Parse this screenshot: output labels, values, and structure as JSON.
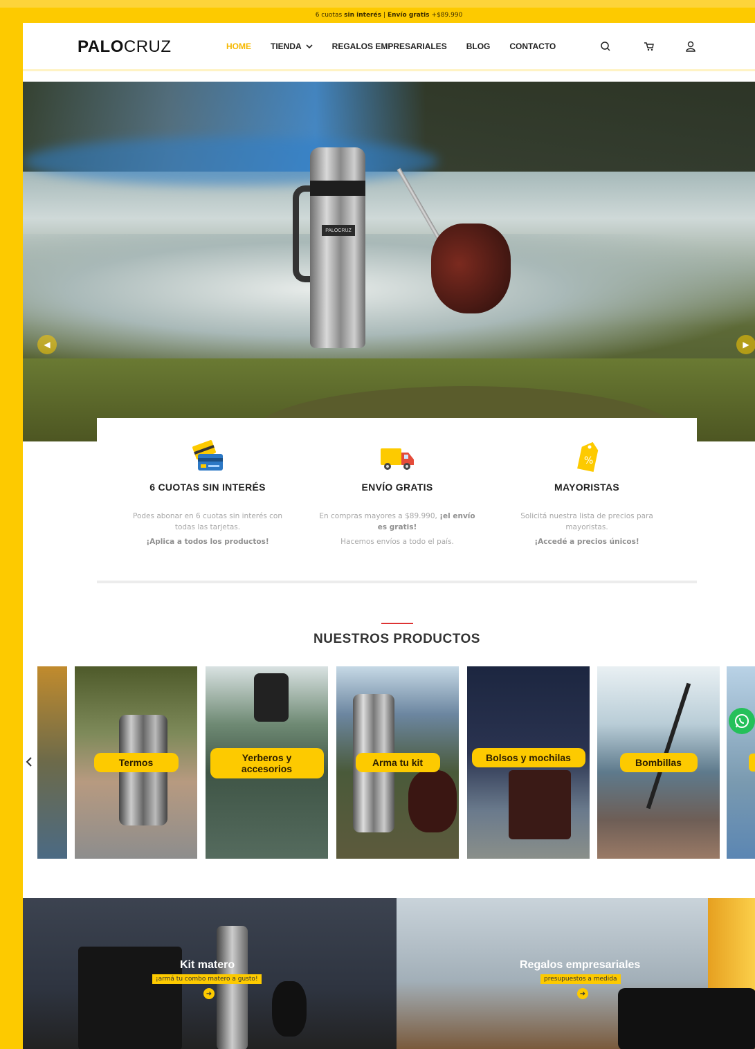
{
  "colors": {
    "accent": "#fdca00",
    "active_nav": "#f6b800",
    "title_line": "#dd3333",
    "whatsapp": "#25c05a"
  },
  "topbar": {
    "part1": "6 cuotas",
    "part2": "sin interés",
    "part3": "|",
    "part4": "Envío gratis",
    "part5": "+$89.990"
  },
  "header": {
    "logo_bold": "PALO",
    "logo_light": "CRUZ",
    "nav": [
      {
        "label": "HOME",
        "active": true
      },
      {
        "label": "TIENDA",
        "dropdown": true
      },
      {
        "label": "REGALOS EMPRESARIALES"
      },
      {
        "label": "BLOG"
      },
      {
        "label": "CONTACTO"
      }
    ],
    "icons": [
      "search-icon",
      "cart-icon",
      "user-icon"
    ]
  },
  "hero": {
    "thermos_label": "PALOCRUZ",
    "prev_icon": "chevron-left-icon",
    "next_icon": "chevron-right-icon"
  },
  "features": [
    {
      "icon": "credit-card-icon",
      "title": "6 CUOTAS SIN INTERÉS",
      "text": "Podes abonar en 6 cuotas sin interés con todas las tarjetas.",
      "highlight": "¡Aplica a todos los productos!"
    },
    {
      "icon": "truck-icon",
      "title": "ENVÍO GRATIS",
      "text_prefix": "En compras mayores a $89.990, ",
      "text_bold": "¡el envío es gratis!",
      "highlight": "Hacemos envíos a todo el país."
    },
    {
      "icon": "price-tag-icon",
      "title": "MAYORISTAS",
      "text": "Solicitá nuestra lista de precios para mayoristas.",
      "highlight": "¡Accedé a precios únicos!"
    }
  ],
  "products": {
    "title": "NUESTROS PRODUCTOS",
    "items": [
      {
        "label": "Termos"
      },
      {
        "label": "Yerberos y accesorios"
      },
      {
        "label": "Arma tu kit"
      },
      {
        "label": "Bolsos y mochilas"
      },
      {
        "label": "Bombillas"
      }
    ]
  },
  "promos": [
    {
      "title": "Kit matero",
      "subtitle": "¡armá tu combo matero a gusto!"
    },
    {
      "title": "Regalos empresariales",
      "subtitle": "presupuestos a medida"
    }
  ]
}
